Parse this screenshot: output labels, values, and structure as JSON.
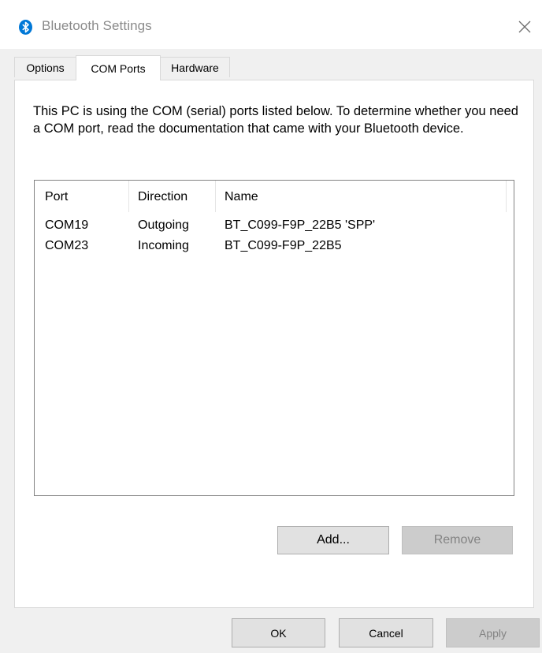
{
  "window": {
    "title": "Bluetooth Settings",
    "icon": "bluetooth-icon",
    "accent": "#0078d7"
  },
  "tabs": [
    {
      "label": "Options",
      "active": false
    },
    {
      "label": "COM Ports",
      "active": true
    },
    {
      "label": "Hardware",
      "active": false
    }
  ],
  "com_ports": {
    "description": "This PC is using the COM (serial) ports listed below. To determine whether you need a COM port, read the documentation that came with your Bluetooth device.",
    "columns": [
      "Port",
      "Direction",
      "Name"
    ],
    "rows": [
      {
        "port": "COM19",
        "direction": "Outgoing",
        "name": "BT_C099-F9P_22B5 'SPP'"
      },
      {
        "port": "COM23",
        "direction": "Incoming",
        "name": "BT_C099-F9P_22B5"
      }
    ],
    "add_label": "Add...",
    "remove_label": "Remove"
  },
  "footer": {
    "ok_label": "OK",
    "cancel_label": "Cancel",
    "apply_label": "Apply"
  }
}
